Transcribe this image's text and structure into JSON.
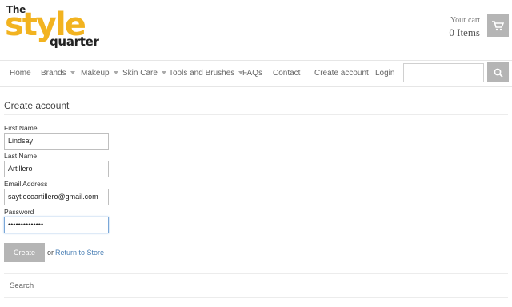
{
  "logo": {
    "line1": "The",
    "line2": "style",
    "line3": "quarter"
  },
  "cart": {
    "label": "Your cart",
    "count": "0 Items",
    "icon": "cart-icon"
  },
  "nav": {
    "items": [
      {
        "label": "Home"
      },
      {
        "label": "Brands"
      },
      {
        "label": "Makeup"
      },
      {
        "label": "Skin Care"
      },
      {
        "label": "Tools and Brushes"
      },
      {
        "label": "FAQs"
      },
      {
        "label": "Contact"
      },
      {
        "label": "Create account"
      },
      {
        "label": "Login"
      }
    ],
    "search_value": "",
    "search_icon": "search-icon"
  },
  "page": {
    "title": "Create account",
    "fields": {
      "first_name": {
        "label": "First Name",
        "value": "Lindsay"
      },
      "last_name": {
        "label": "Last Name",
        "value": "Artillero"
      },
      "email": {
        "label": "Email Address",
        "value": "saytiocoartillero@gmail.com"
      },
      "password": {
        "label": "Password",
        "value": "••••••••••••••"
      }
    },
    "create_label": "Create",
    "or_text": "or",
    "return_label": "Return to Store"
  },
  "footer": {
    "search_label": "Search"
  },
  "colors": {
    "brand_yellow": "#f2b320",
    "button_grey": "#b5b5b5",
    "link_blue": "#4a7fb5"
  }
}
